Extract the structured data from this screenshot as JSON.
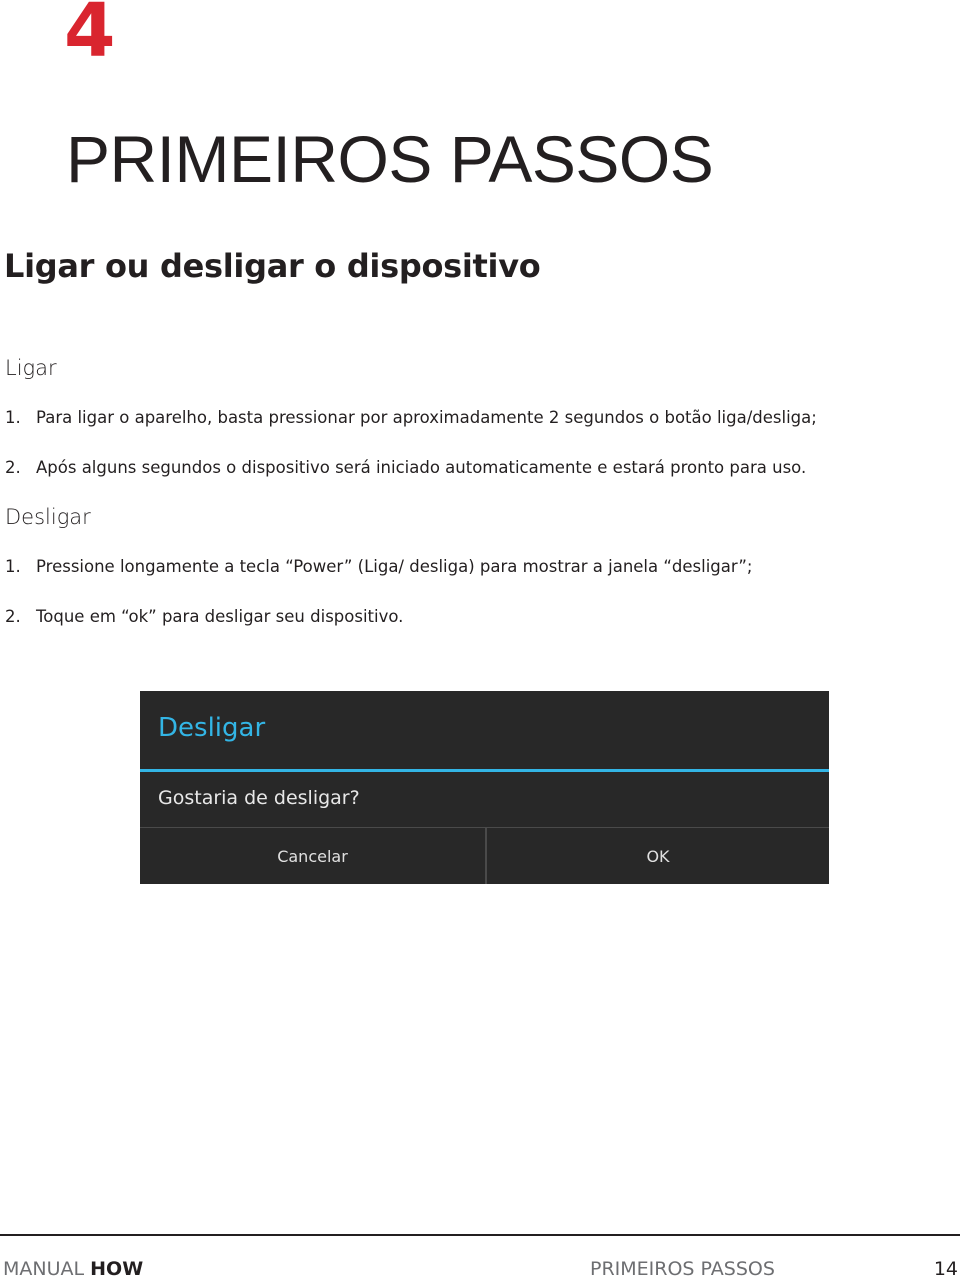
{
  "chapter": {
    "number": "4",
    "title": "PRIMEIROS PASSOS",
    "accent_color": "#d9252f"
  },
  "section": {
    "title": "Ligar ou desligar o dispositivo"
  },
  "ligar": {
    "heading": "Ligar",
    "steps": [
      {
        "num": "1.",
        "text": "Para ligar o aparelho, basta pressionar por aproximadamente 2 segundos o botão liga/desliga;"
      },
      {
        "num": "2.",
        "text": "Após alguns segundos o dispositivo será iniciado automaticamente e estará pronto para uso."
      }
    ]
  },
  "desligar": {
    "heading": "Desligar",
    "steps": [
      {
        "num": "1.",
        "text": "Pressione longamente a tecla “Power” (Liga/ desliga) para mostrar a janela “desligar”;"
      },
      {
        "num": "2.",
        "text": "Toque em “ok” para desligar seu dispositivo."
      }
    ]
  },
  "dialog": {
    "title": "Desligar",
    "message": "Gostaria de desligar?",
    "cancel_label": "Cancelar",
    "ok_label": "OK",
    "accent_color": "#33b5e5",
    "background_color": "#282828"
  },
  "footer": {
    "brand_light": "MANUAL",
    "brand_bold": "HOW",
    "section": "PRIMEIROS PASSOS",
    "page_number": "14"
  }
}
